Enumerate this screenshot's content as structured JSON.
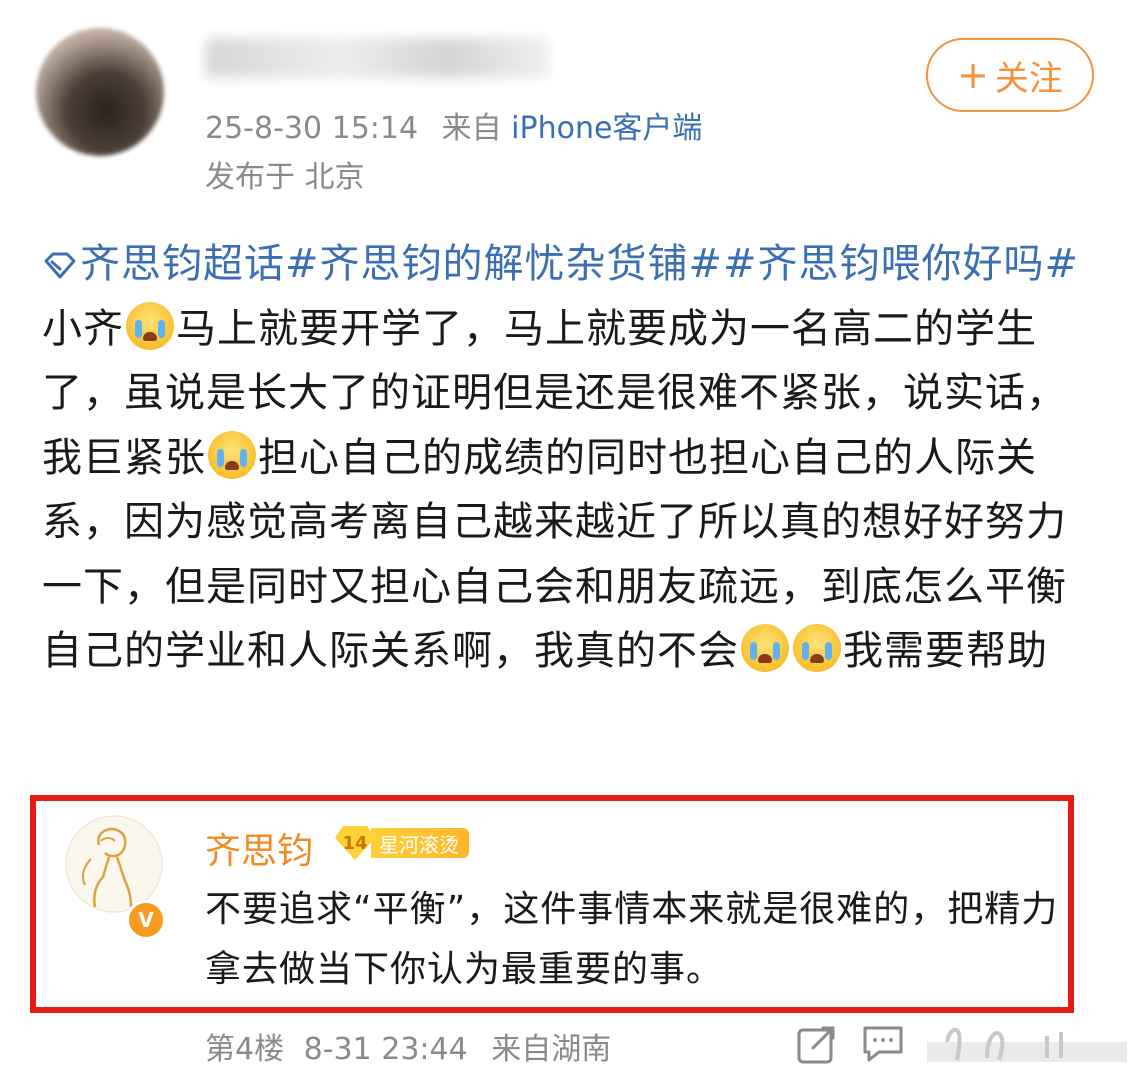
{
  "post": {
    "author_name": "",
    "time": "25-8-30 15:14",
    "source_prefix": "来自",
    "source": "iPhone客户端",
    "location": "发布于 北京",
    "follow_plus": "+",
    "follow_label": "关注",
    "topic_super": "齐思钧超话",
    "topic_1": "#齐思钧的解忧杂货铺#",
    "topic_2": "#齐思钧喂你好吗#",
    "text_1": " 小齐",
    "text_2": "马上就要开学了，马上就要成为一名高二的学生了，虽说是长大了的证明但是还是很难不紧张，说实话，我巨紧张",
    "text_3": "担心自己的成绩的同时也担心自己的人际关系，因为感觉高考离自己越来越近了所以真的想好好努力一下，但是同时又担心自己会和朋友疏远，到底怎么平衡自己的学业和人际关系啊，我真的不会",
    "text_4": "我需要帮助"
  },
  "reply": {
    "name": "齐思钧",
    "fan_level": "14",
    "fan_label": "星河滚烫",
    "text": "不要追求“平衡”，这件事情本来就是很难的，把精力拿去做当下你认为最重要的事。",
    "floor": "第4楼",
    "time": "8-31 23:44",
    "location": "来自湖南",
    "highlight_color": "#e81b1b"
  },
  "icons": [
    "diamond-icon",
    "crying-emoji",
    "share-icon",
    "comment-icon",
    "like-icon",
    "verified-v-icon"
  ]
}
